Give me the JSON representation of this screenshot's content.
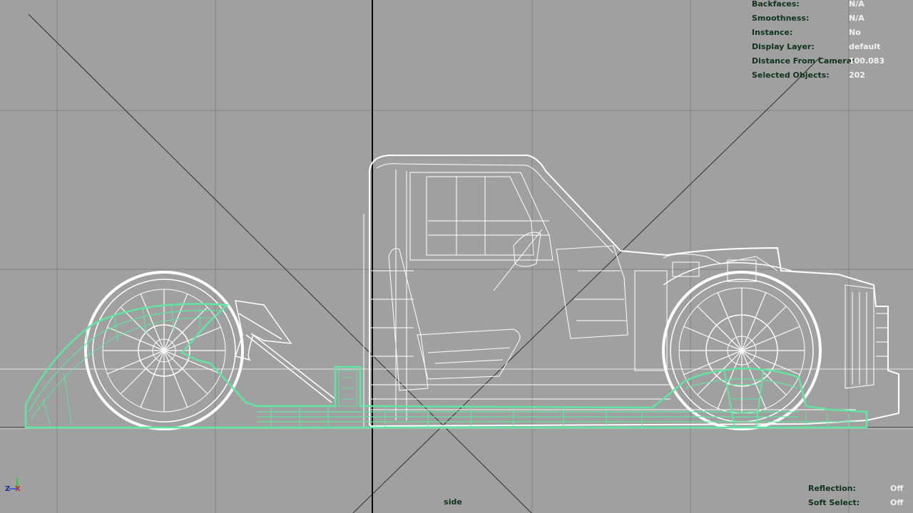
{
  "viewport": {
    "camera_name": "side",
    "background_color": "#a0a0a0",
    "selection_color": "#5fe6a0",
    "wireframe_color": "#ffffff",
    "hud_label_color": "#0d3318",
    "hud_value_color": "#f2f2f2"
  },
  "hud_top_right": [
    {
      "label": "Backfaces:",
      "value": "N/A"
    },
    {
      "label": "Smoothness:",
      "value": "N/A"
    },
    {
      "label": "Instance:",
      "value": "No"
    },
    {
      "label": "Display Layer:",
      "value": "default"
    },
    {
      "label": "Distance From Camera:",
      "value": "100.083"
    },
    {
      "label": "Selected Objects:",
      "value": "202"
    }
  ],
  "hud_bottom_right": [
    {
      "label": "Reflection:",
      "value": "Off"
    },
    {
      "label": "Soft Select:",
      "value": "Off"
    }
  ],
  "axis_gizmo": {
    "z": "Z",
    "x": "X",
    "icon": "axis-gizmo-icon"
  }
}
